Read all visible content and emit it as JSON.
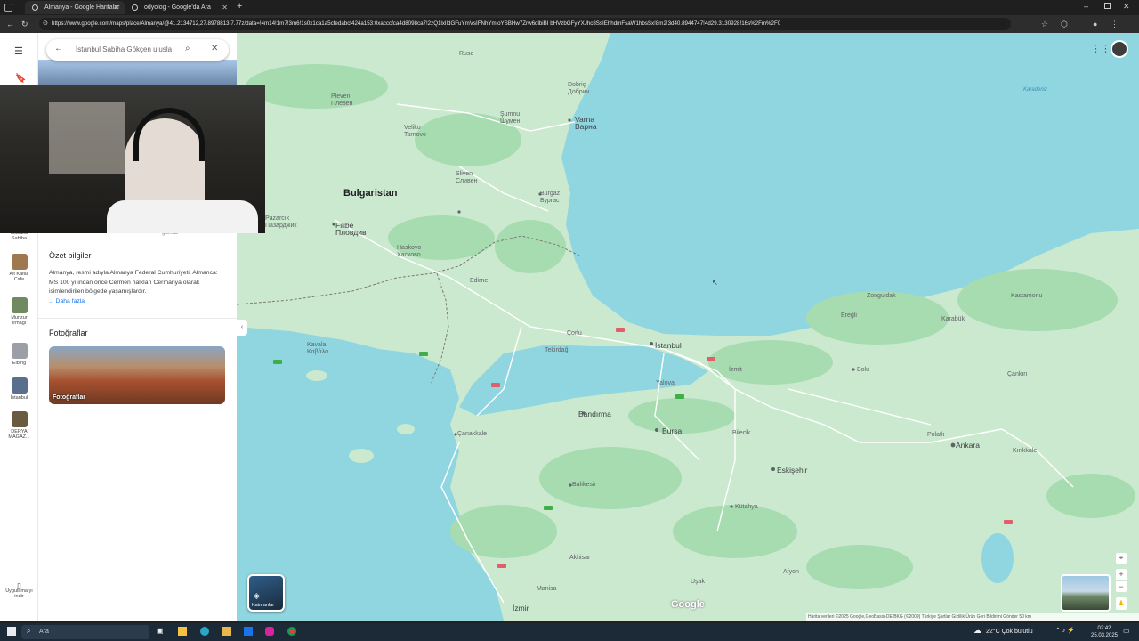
{
  "browser": {
    "tabs": [
      {
        "label": "Almanya - Google Haritalar",
        "active": true
      },
      {
        "label": "odyolog - Google'da Ara",
        "active": false
      }
    ],
    "new_tab_glyph": "+",
    "url": "https://www.google.com/maps/place/Almanya/@41.2134712,27.8978813,7.77z/data=!4m14!1m7!3m6!1s0x1ca1a5cfedabcf424a153:0xacccfca4d8098ca7!2zQ1lxIldGFuYmVsIFNhYmloYSBHw7Zrw6dlbiBI bHVzbGFyYXJhc8SsIEhhdmFsaW1hbsSx!8m2!3d40.8944747!4d29.3130928!16s%2Fm%2F0"
  },
  "search": {
    "placeholder": "İstanbul Sabiha Gökçen ulusla"
  },
  "left_strip": {
    "items": [
      {
        "label": "İstanbul Sabiha",
        "color": "#8fa8c8"
      },
      {
        "label": "Alt Kafalı Cafe",
        "color": "#a07850"
      },
      {
        "label": "Munzur Irmağı",
        "color": "#6e8a5e"
      },
      {
        "label": "Elbing",
        "color": "#9aa0a6"
      },
      {
        "label": "İstanbul",
        "color": "#5a6f8c"
      },
      {
        "label": "DERYA MAGAZ...",
        "color": "#6a5a40"
      }
    ],
    "bottom_label": "Uygulama yı indir"
  },
  "panel": {
    "peek_label": "gamab",
    "summary_title": "Özet bilgiler",
    "summary_text": "Almanya, resmi adıyla Almanya Federal Cumhuriyeti; Almanca: MS 100 yılından önce Cermen halkları Cermanya olarak isimlendirilen bölgede yaşamışlardır.",
    "more_link": "... Daha fazla",
    "photos_title": "Fotoğraflar",
    "photo_caption": "Fotoğraflar"
  },
  "map": {
    "labels": {
      "country": "Bulgaristan",
      "varna": "Varna\nВарна",
      "burgaz": "Burgaz\nБургас",
      "sliven": "Sliven\nСливен",
      "filibe": "Filibe\nПловдив",
      "istanbul": "İstanbul",
      "bursa": "Bursa",
      "ankara": "Ankara",
      "eskisehir": "Eskişehir",
      "izmir": "İzmir",
      "kocaeli": "İzmit",
      "bolu": "Bolu",
      "zonguldak": "Zonguldak",
      "karabuk": "Karabük",
      "kutahya": "Kütahya",
      "bandirma": "Bandırma",
      "canakkale": "Çanakkale",
      "balikesir": "Balıkesir",
      "manisa": "Manisa",
      "edirne": "Edirne",
      "tekirdag": "Tekirdağ",
      "corlu": "Çorlu",
      "kavala": "Kavala\nΚαβάλα",
      "kirikkale": "Kırıkkale",
      "dobric": "Dobriç\nДобрич",
      "sumnu": "Şumnu\nШумен",
      "haskovo": "Haskovo\nХасково",
      "karadeniz": "Karadeniz",
      "usak": "Uşak",
      "afyon": "Afyon",
      "cankiri": "Çankırı",
      "kastamonu": "Kastamonu",
      "eregli": "Ereğli",
      "yalova": "Yalova",
      "bilecik": "Bilecik",
      "akhisar": "Akhisar",
      "polatli": "Polatlı",
      "pleven": "Pleven\nПлевен",
      "velikoturnovo": "Veliko\nTarnovo",
      "pazarcik": "Pazarcık\nПазарджик",
      "ruse": "Ruse"
    },
    "google_logo": "Google",
    "layers_label": "Katmanlar",
    "attribution": "Harita verileri ©2025 Google,GeoBasis-DE/BKG (©2009)   Türkiye   Şartlar   Gizlilik   Ürün Geri Bildirimi Gönder   50 km"
  },
  "taskbar": {
    "search_placeholder": "Ara",
    "weather": "22°C  Çok bulutlu",
    "time": "02:42",
    "date": "25.03.2025"
  },
  "colors": {
    "land": "#cbe9ce",
    "forest": "#a6dcb0",
    "sea": "#90d6e0",
    "road": "#ffffff",
    "border": "#7a7a7a",
    "highway": "#f2c87c"
  }
}
